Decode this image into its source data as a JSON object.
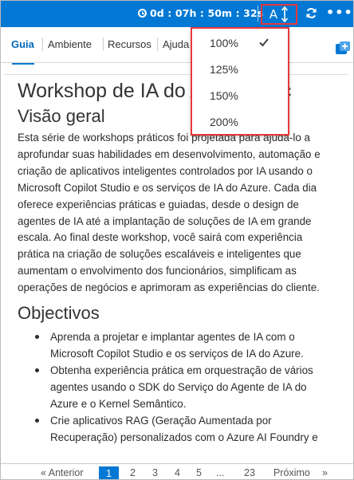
{
  "timer": {
    "text": "0d : 07h : 50m : 32s"
  },
  "toolbar": {
    "font_button_label": "A"
  },
  "tabs": [
    {
      "label": "Guia"
    },
    {
      "label": "Ambiente"
    },
    {
      "label": "Recursos"
    },
    {
      "label": "Ajuda"
    }
  ],
  "font_size_menu": {
    "options": [
      "100%",
      "125%",
      "150%",
      "200%"
    ],
    "selected": "100%"
  },
  "doc": {
    "title": "Workshop de IA do A",
    "title_tail": "c",
    "overview_heading": "Visão geral",
    "overview_text": "Esta série de workshops práticos foi projetada para ajudá-lo a aprofundar suas habilidades em desenvolvimento, automação e criação de aplicativos inteligentes controlados por IA usando o Microsoft Copilot Studio e os serviços de IA do Azure. Cada dia oferece experiências práticas e guiadas, desde o design de agentes de IA até a implantação de soluções de IA em grande escala. Ao final deste workshop, você sairá com experiência prática na criação de soluções escaláveis e inteligentes que aumentam o envolvimento dos funcionários, simplificam as operações de negócios e aprimoram as experiências do cliente.",
    "objectives_heading": "Objectivos",
    "objectives": [
      "Aprenda a projetar e implantar agentes de IA com o Microsoft Copilot Studio e os serviços de IA do Azure.",
      "Obtenha experiência prática em orquestração de vários agentes usando o SDK do Serviço do Agente de IA do Azure e o Kernel Semântico.",
      "Crie aplicativos RAG (Geração Aumentada por Recuperação) personalizados com o Azure AI Foundry e"
    ]
  },
  "pagination": {
    "prev": "« Anterior",
    "pages": [
      "1",
      "2",
      "3",
      "4",
      "5",
      "...",
      "23"
    ],
    "current": "1",
    "next": "Próximo",
    "next_arrow": "»"
  },
  "colors": {
    "accent": "#0078d4",
    "highlight": "#e8383a"
  }
}
